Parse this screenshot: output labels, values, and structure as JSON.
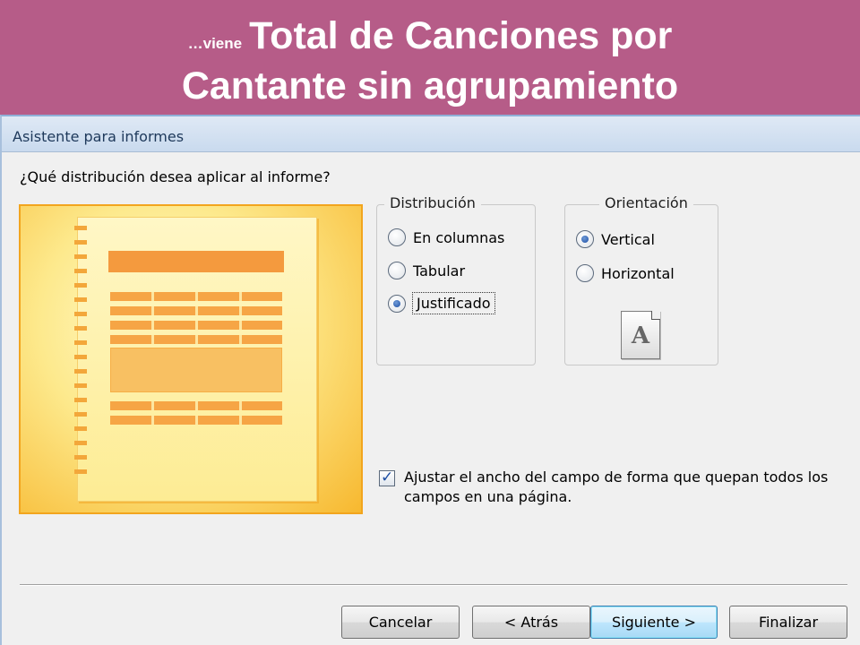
{
  "slide": {
    "prefix": "…viene",
    "title_line1": "Total de Canciones por",
    "title_line2": "Cantante sin agrupamiento"
  },
  "dialog": {
    "title": "Asistente para informes",
    "question": "¿Qué distribución desea aplicar al informe?",
    "distribution": {
      "label": "Distribución",
      "options": [
        {
          "label": "En columnas",
          "checked": false
        },
        {
          "label": "Tabular",
          "checked": false
        },
        {
          "label": "Justificado",
          "checked": true
        }
      ]
    },
    "orientation": {
      "label": "Orientación",
      "options": [
        {
          "label": "Vertical",
          "checked": true
        },
        {
          "label": "Horizontal",
          "checked": false
        }
      ],
      "icon_letter": "A"
    },
    "fit_checkbox": {
      "checked": true,
      "line1": "Ajustar el ancho del campo de forma que quepan todos los",
      "line2": "campos en una página."
    },
    "buttons": {
      "cancel": "Cancelar",
      "back": "< Atrás",
      "next": "Siguiente >",
      "finish": "Finalizar"
    }
  },
  "colors": {
    "slide_background": "#b65c88",
    "dialog_background": "#f0f0f0",
    "preview_accent": "#f49a3e"
  }
}
